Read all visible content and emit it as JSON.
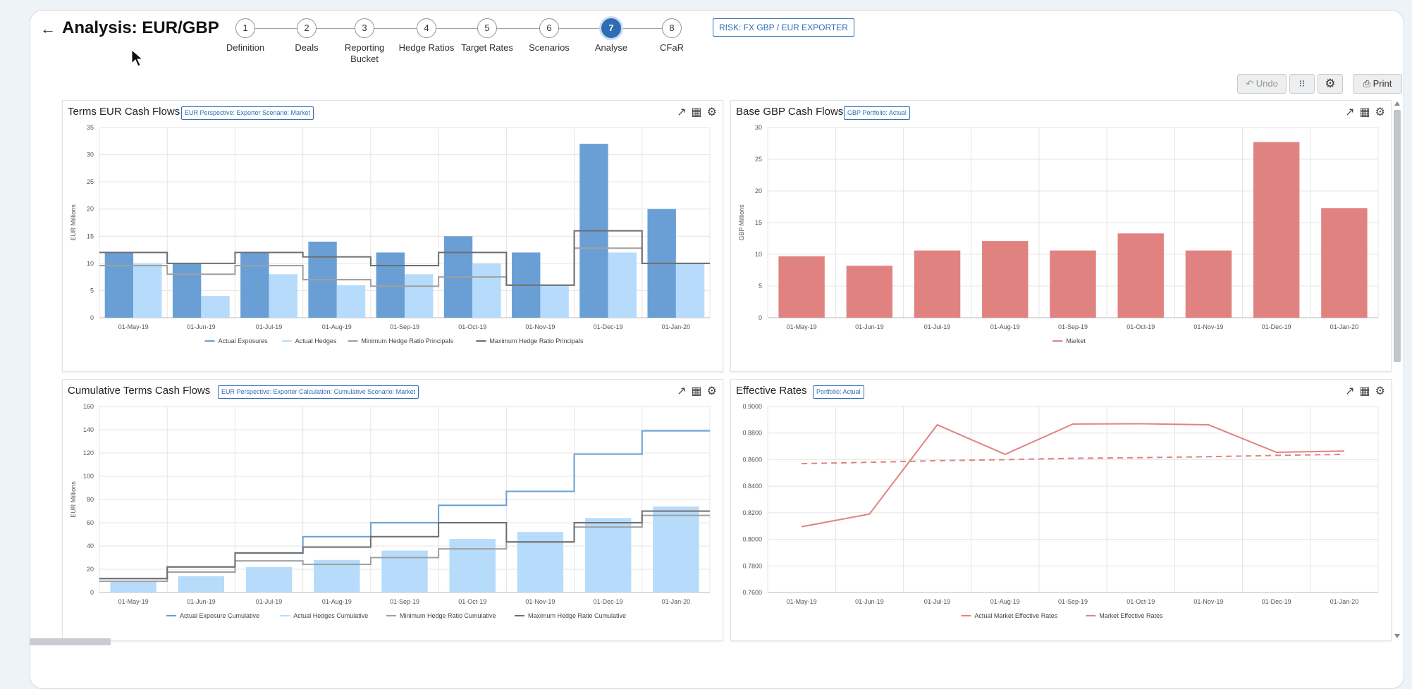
{
  "header": {
    "back_icon": "back-arrow-icon",
    "title": "Analysis: EUR/GBP",
    "risk_badge": "RISK: FX GBP / EUR EXPORTER"
  },
  "steps": [
    {
      "num": "1",
      "label": "Definition"
    },
    {
      "num": "2",
      "label": "Deals"
    },
    {
      "num": "3",
      "label": "Reporting Bucket"
    },
    {
      "num": "4",
      "label": "Hedge Ratios"
    },
    {
      "num": "5",
      "label": "Target Rates"
    },
    {
      "num": "6",
      "label": "Scenarios"
    },
    {
      "num": "7",
      "label": "Analyse",
      "active": true
    },
    {
      "num": "8",
      "label": "CFaR"
    }
  ],
  "toolbar": {
    "undo_label": "Undo",
    "print_label": "Print",
    "icons": [
      "undo-icon",
      "grid-icon",
      "gear-icon",
      "print-icon"
    ]
  },
  "panels": {
    "terms": {
      "title": "Terms EUR Cash Flows",
      "badge": "EUR Perspective: Exporter Scenario: Market"
    },
    "base": {
      "title": "Base GBP Cash Flows",
      "badge": "GBP Portfolio: Actual"
    },
    "cumulative": {
      "title": "Cumulative Terms Cash Flows",
      "badge": "EUR Perspective: Exporter Calculation: Cumulative Scenario: Market"
    },
    "rates": {
      "title": "Effective Rates",
      "badge": "Portfolio: Actual"
    }
  },
  "colors": {
    "exposure": "#6a9fd6",
    "hedge": "#b7dbfb",
    "minline": "#a0a0a0",
    "maxline": "#6e6e6e",
    "market": "#e08380",
    "accent": "#2e6db4"
  },
  "chart_data": [
    {
      "type": "bar",
      "id": "terms",
      "categories": [
        "01-May-19",
        "01-Jun-19",
        "01-Jul-19",
        "01-Aug-19",
        "01-Sep-19",
        "01-Oct-19",
        "01-Nov-19",
        "01-Dec-19",
        "01-Jan-20"
      ],
      "ylabel": "EUR Millions",
      "ylim": [
        0,
        35
      ],
      "yticks": [
        0,
        5,
        10,
        15,
        20,
        25,
        30,
        35
      ],
      "series": [
        {
          "name": "Actual Exposures",
          "kind": "bar",
          "values": [
            12,
            10,
            12,
            14,
            12,
            15,
            12,
            32,
            20
          ]
        },
        {
          "name": "Actual Hedges",
          "kind": "bar",
          "values": [
            10,
            4,
            8,
            6,
            8,
            10,
            6,
            12,
            10
          ]
        },
        {
          "name": "Minimum Hedge Ratio Principals",
          "kind": "step",
          "values": [
            9.6,
            8,
            9.6,
            7,
            5.8,
            7.5,
            6,
            12.8,
            10
          ]
        },
        {
          "name": "Maximum Hedge Ratio Principals",
          "kind": "step",
          "values": [
            12,
            10,
            12,
            11.2,
            9.6,
            12,
            6,
            16,
            10
          ]
        }
      ],
      "grid": true,
      "legend": "bottom"
    },
    {
      "type": "bar",
      "id": "base",
      "categories": [
        "01-May-19",
        "01-Jun-19",
        "01-Jul-19",
        "01-Aug-19",
        "01-Sep-19",
        "01-Oct-19",
        "01-Nov-19",
        "01-Dec-19",
        "01-Jan-20"
      ],
      "ylabel": "GBP Millions",
      "ylim": [
        0,
        30
      ],
      "yticks": [
        0,
        5,
        10,
        15,
        20,
        25,
        30
      ],
      "series": [
        {
          "name": "Market",
          "kind": "bar",
          "values": [
            9.7,
            8.2,
            10.6,
            12.1,
            10.6,
            13.3,
            10.6,
            27.7,
            17.3
          ]
        }
      ],
      "grid": true,
      "legend": "bottom"
    },
    {
      "type": "bar",
      "id": "cumulative",
      "categories": [
        "01-May-19",
        "01-Jun-19",
        "01-Jul-19",
        "01-Aug-19",
        "01-Sep-19",
        "01-Oct-19",
        "01-Nov-19",
        "01-Dec-19",
        "01-Jan-20"
      ],
      "ylabel": "EUR Millions",
      "ylim": [
        0,
        160
      ],
      "yticks": [
        0,
        20,
        40,
        60,
        80,
        100,
        120,
        140,
        160
      ],
      "series": [
        {
          "name": "Actual Exposure Cumulative",
          "kind": "step",
          "values": [
            12,
            22,
            34,
            48,
            60,
            75,
            87,
            119,
            139
          ]
        },
        {
          "name": "Actual Hedges Cumulative",
          "kind": "bar",
          "values": [
            10,
            14,
            22,
            28,
            36,
            46,
            52,
            64,
            74
          ]
        },
        {
          "name": "Minimum Hedge Ratio Cumulative",
          "kind": "step",
          "values": [
            9.6,
            17.6,
            27.2,
            24.2,
            30,
            37.5,
            43.5,
            56.3,
            66.3
          ]
        },
        {
          "name": "Maximum Hedge Ratio Cumulative",
          "kind": "step",
          "values": [
            12,
            22,
            34,
            39,
            48,
            60,
            43.5,
            60,
            70
          ]
        }
      ],
      "grid": true,
      "legend": "bottom"
    },
    {
      "type": "line",
      "id": "rates",
      "categories": [
        "01-May-19",
        "01-Jun-19",
        "01-Jul-19",
        "01-Aug-19",
        "01-Sep-19",
        "01-Oct-19",
        "01-Nov-19",
        "01-Dec-19",
        "01-Jan-20"
      ],
      "ylim": [
        0.76,
        0.9
      ],
      "yticks": [
        "0.7600",
        "0.7800",
        "0.8000",
        "0.8200",
        "0.8400",
        "0.8600",
        "0.8800",
        "0.9000"
      ],
      "series": [
        {
          "name": "Actual Market Effective Rates",
          "kind": "line",
          "dashed": false,
          "values": [
            0.8095,
            0.819,
            0.8862,
            0.864,
            0.8868,
            0.887,
            0.8862,
            0.8655,
            0.8665
          ]
        },
        {
          "name": "Market Effective Rates",
          "kind": "line",
          "dashed": true,
          "values": [
            0.857,
            0.858,
            0.8592,
            0.86,
            0.861,
            0.8615,
            0.8622,
            0.8632,
            0.864
          ]
        }
      ],
      "grid": true,
      "legend": "bottom"
    }
  ]
}
